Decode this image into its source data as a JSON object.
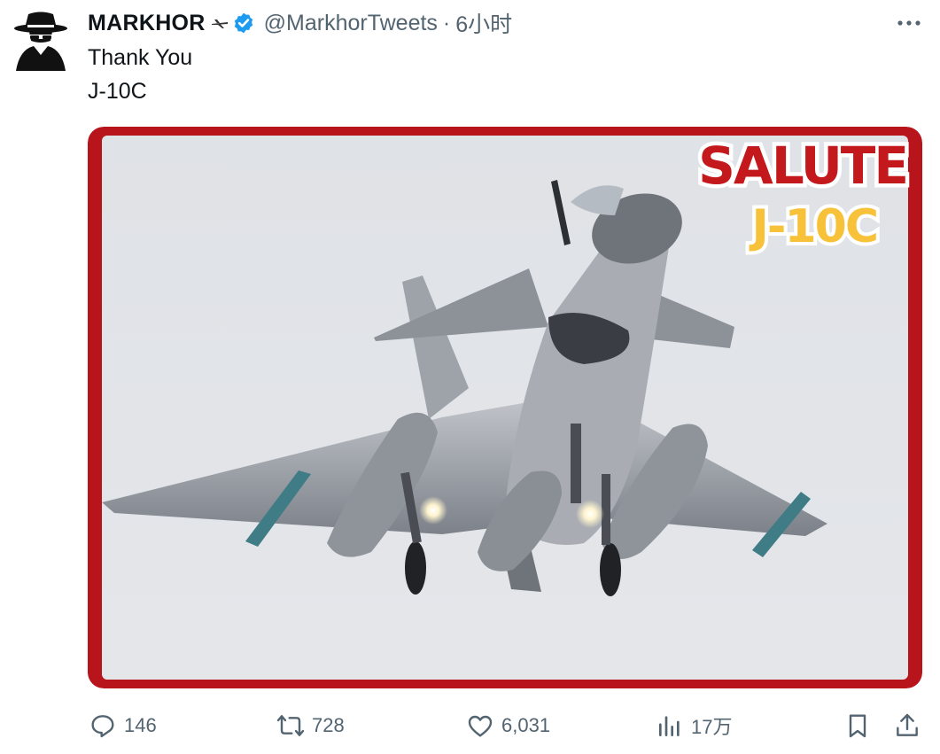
{
  "author": {
    "name": "MARKHOR",
    "handle": "@MarkhorTweets",
    "separator": "·",
    "time": "6小时"
  },
  "tweet": {
    "line1": "Thank You",
    "line2": "J-10C"
  },
  "media": {
    "overlay_title": "SALUTE",
    "overlay_subtitle": "J-10C",
    "frame_color": "#b8141c",
    "sky_color": "#dfe2e7"
  },
  "actions": {
    "replies": "146",
    "retweets": "728",
    "likes": "6,031",
    "views": "17万"
  },
  "icons": [
    "spy-avatar-icon",
    "plane-affiliation-icon",
    "verified-badge-icon",
    "more-icon",
    "reply-icon",
    "retweet-icon",
    "like-icon",
    "views-icon",
    "bookmark-icon",
    "share-icon"
  ],
  "colors": {
    "verified": "#1d9bf0",
    "secondary_text": "#536471",
    "text": "#0f1419"
  }
}
